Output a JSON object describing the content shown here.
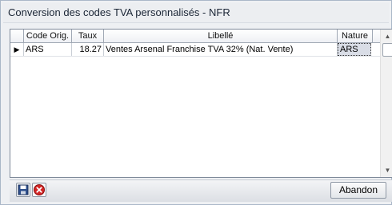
{
  "window": {
    "title": "Conversion des codes TVA personnalisés - NFR"
  },
  "grid": {
    "columns": [
      "",
      "Code Orig.",
      "Taux",
      "Libellé",
      "Nature"
    ],
    "rows": [
      {
        "indicator": "▶",
        "code_orig": "ARS",
        "taux": "18.27",
        "libelle": "Ventes Arsenal Franchise TVA 32% (Nat. Vente)",
        "nature": "ARS"
      }
    ]
  },
  "toolbar": {
    "save_icon": "floppy-disk-icon",
    "cancel_icon": "red-x-circle-icon",
    "abandon_label": "Abandon"
  },
  "scrollbar": {
    "up": "▲",
    "down": "▼"
  }
}
